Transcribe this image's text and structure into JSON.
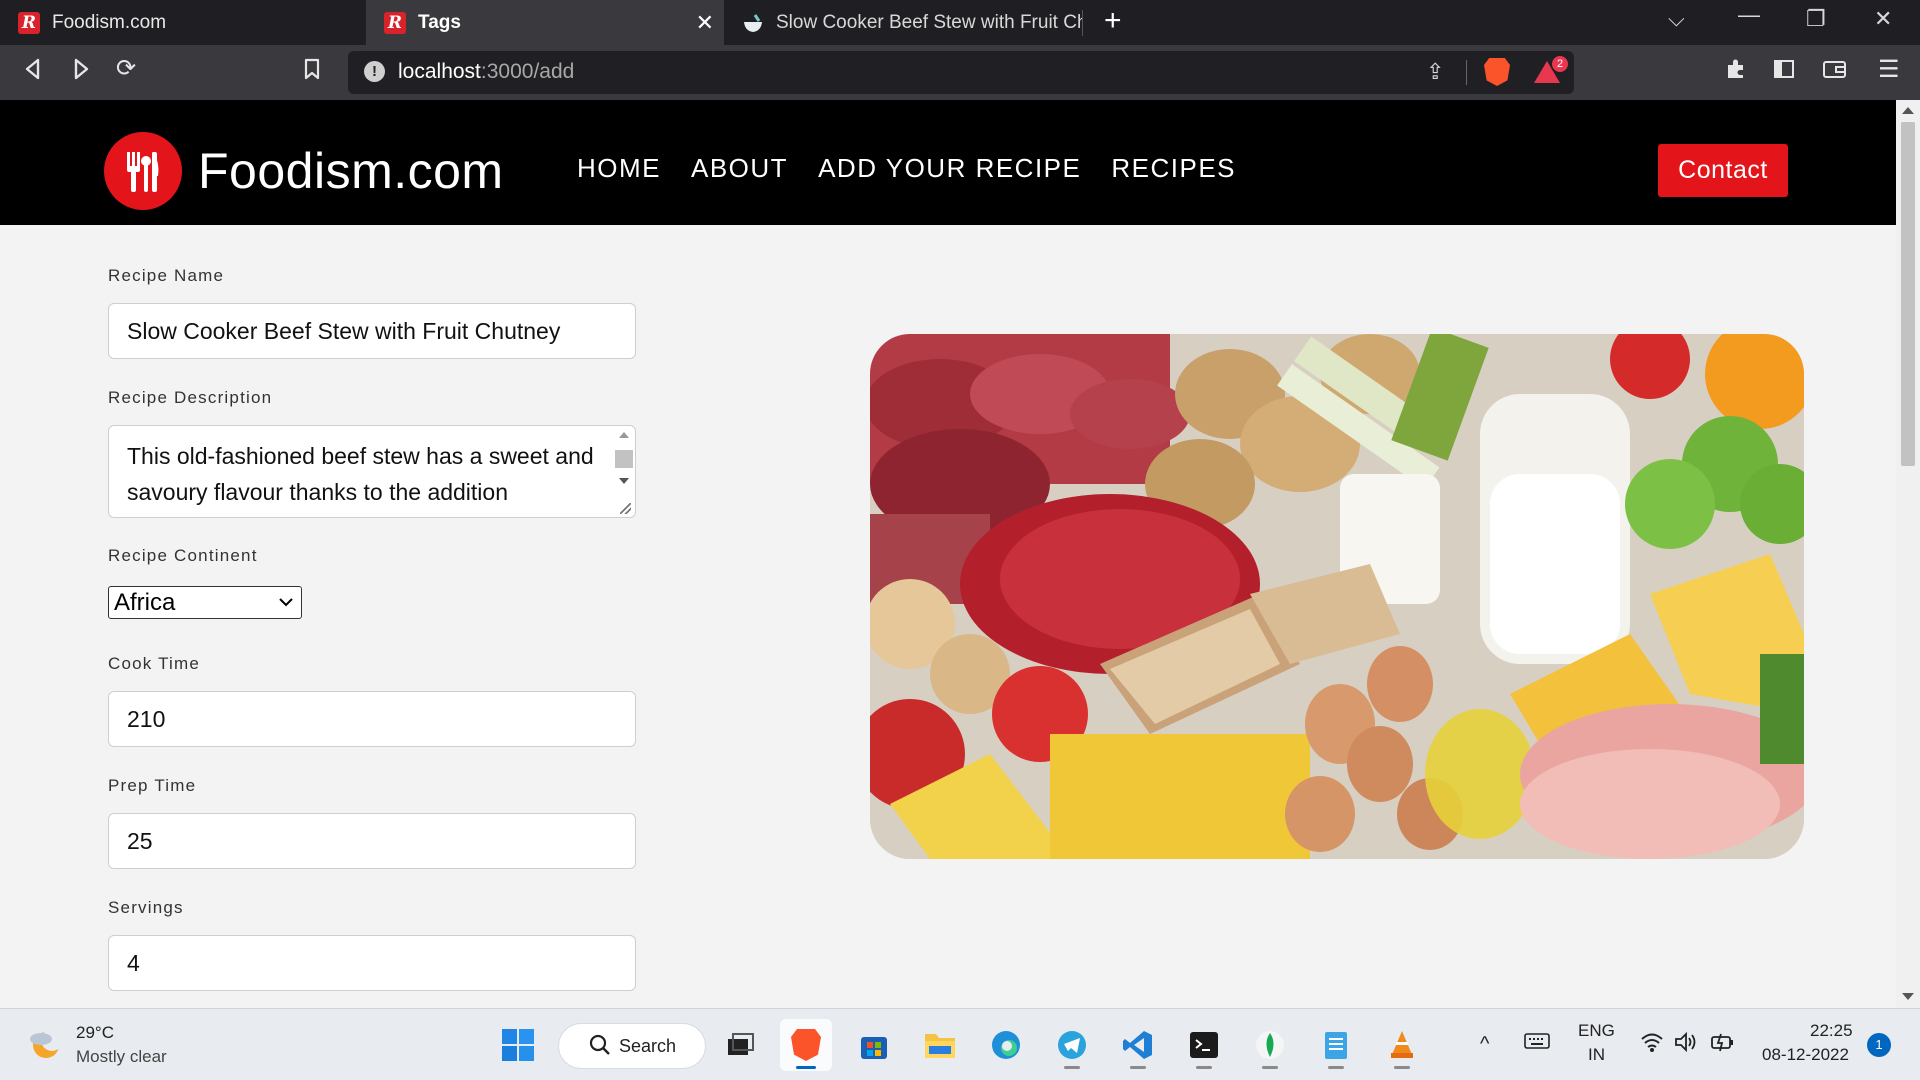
{
  "browser": {
    "tabs": [
      {
        "title": "Foodism.com",
        "active": false
      },
      {
        "title": "Tags",
        "active": true
      },
      {
        "title": "Slow Cooker Beef Stew with Fruit Chut",
        "active": false
      }
    ],
    "url_host": "localhost",
    "url_path": ":3000/add",
    "brave_badge": "2"
  },
  "site": {
    "logo_text": "Foodism.com",
    "nav": [
      "HOME",
      "ABOUT",
      "ADD YOUR RECIPE",
      "RECIPES"
    ],
    "contact_label": "Contact"
  },
  "form": {
    "name_label": "Recipe Name",
    "name_value": "Slow Cooker Beef Stew with Fruit Chutney",
    "description_label": "Recipe Description",
    "description_value": "This old-fashioned beef stew has a sweet and savoury flavour thanks to the addition",
    "continent_label": "Recipe Continent",
    "continent_value": "Africa",
    "cook_time_label": "Cook Time",
    "cook_time_value": "210",
    "prep_time_label": "Prep Time",
    "prep_time_value": "25",
    "servings_label": "Servings",
    "servings_value": "4"
  },
  "taskbar": {
    "weather_temp": "29°C",
    "weather_desc": "Mostly clear",
    "search_label": "Search",
    "lang_line1": "ENG",
    "lang_line2": "IN",
    "time": "22:25",
    "date": "08-12-2022",
    "notifications": "1"
  },
  "colors": {
    "brand_red": "#e4141b",
    "header_bg": "#000000",
    "page_bg": "#f3f3f3"
  }
}
